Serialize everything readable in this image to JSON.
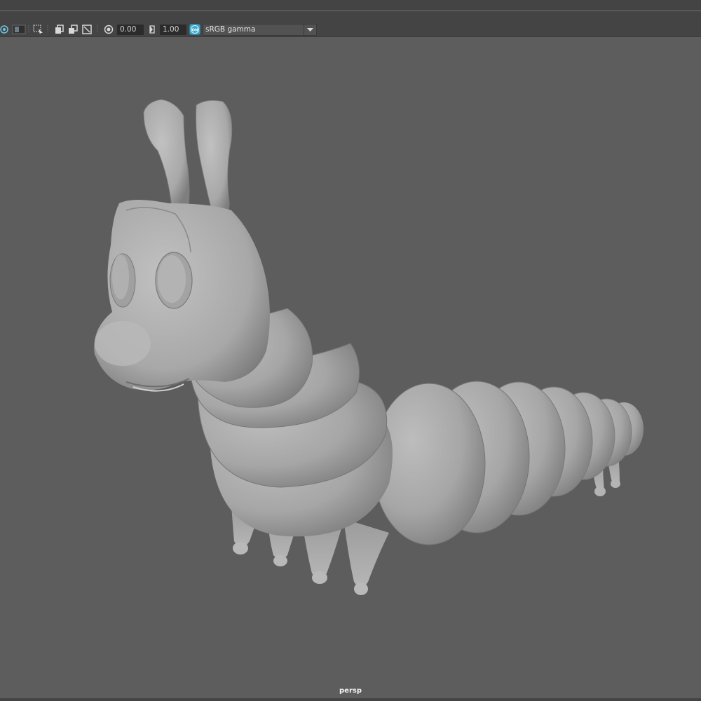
{
  "toolbar": {
    "icons": [
      "isolate-select-icon",
      "xray-toggle-icon",
      "select-camera-icon",
      "grid-toggle-icon",
      "film-gate-icon",
      "resolution-gate-icon",
      "exposure-icon",
      "gamma-icon",
      "color-management-toggle-icon",
      "dropdown-arrow-icon"
    ],
    "exposure_value": "0.00",
    "gamma_value": "1.00",
    "color_management_badge": "ON",
    "view_transform": "sRGB gamma"
  },
  "viewport": {
    "camera_label": "persp",
    "model": "caterpillar-model"
  },
  "colors": {
    "panel": "#444444",
    "viewport_bg": "#5d5d5d",
    "field_bg": "#2b2b2b",
    "accent": "#3aa6c9",
    "model_gray": "#a9a9a9"
  }
}
